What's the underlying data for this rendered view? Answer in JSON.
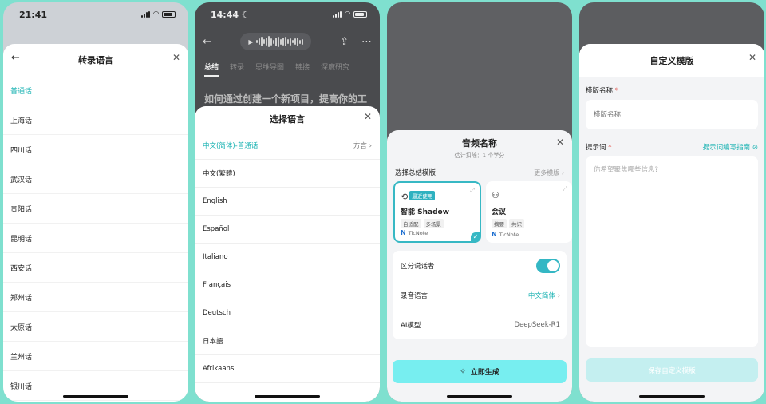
{
  "colors": {
    "background": "#7fe0cf",
    "accent": "#1bb3b3",
    "toggle_on": "#34b7c4",
    "generate_button": "#77eef0",
    "save_button_disabled": "#c4eff0",
    "required_star": "#e2453c"
  },
  "phone1": {
    "status_time": "21:41",
    "sheet_title": "转录语言",
    "back_icon": "arrow-left-icon",
    "close_icon": "close-icon",
    "dialects": [
      "普通话",
      "上海话",
      "四川话",
      "武汉话",
      "贵阳话",
      "昆明话",
      "西安话",
      "郑州话",
      "太原话",
      "兰州话",
      "银川话"
    ],
    "selected_index": 0
  },
  "phone2": {
    "status_time": "14:44",
    "tabs": [
      "总结",
      "转录",
      "思维导图",
      "链接",
      "深度研究"
    ],
    "background_title": "如何通过创建一个新项目，提高你的工",
    "sheet_title": "选择语言",
    "languages": [
      "中文(简体)-普通话",
      "中文(繁體)",
      "English",
      "Español",
      "Italiano",
      "Français",
      "Deutsch",
      "日本語",
      "Afrikaans"
    ],
    "selected_index": 0,
    "dialect_link": "方言"
  },
  "phone3": {
    "sheet_title": "音频名称",
    "sheet_subtitle": "估计扣除：1 个学分",
    "section_label": "选择总结模版",
    "more_templates": "更多模版",
    "cards": [
      {
        "badge": "最近使用",
        "name": "智能 Shadow",
        "tags": [
          "自适配",
          "多场景"
        ],
        "brand": "TicNote",
        "selected": true
      },
      {
        "badge": "",
        "name": "会议",
        "tags": [
          "摘要",
          "共识"
        ],
        "brand": "TicNote",
        "selected": false
      }
    ],
    "speaker_label": "区分说话者",
    "speaker_toggle_on": true,
    "recording_language_label": "录音语言",
    "recording_language_value": "中文简体",
    "ai_model_label": "AI模型",
    "ai_model_value": "DeepSeek-R1",
    "generate_button": "立即生成"
  },
  "phone4": {
    "sheet_title": "自定义模版",
    "template_name_label": "模版名称",
    "template_name_placeholder": "模版名称",
    "prompt_label": "提示词",
    "prompt_guide_link": "提示词编写指南",
    "prompt_placeholder": "你希望聚焦哪些信息?",
    "save_button": "保存自定义模版",
    "required_mark": "*"
  }
}
